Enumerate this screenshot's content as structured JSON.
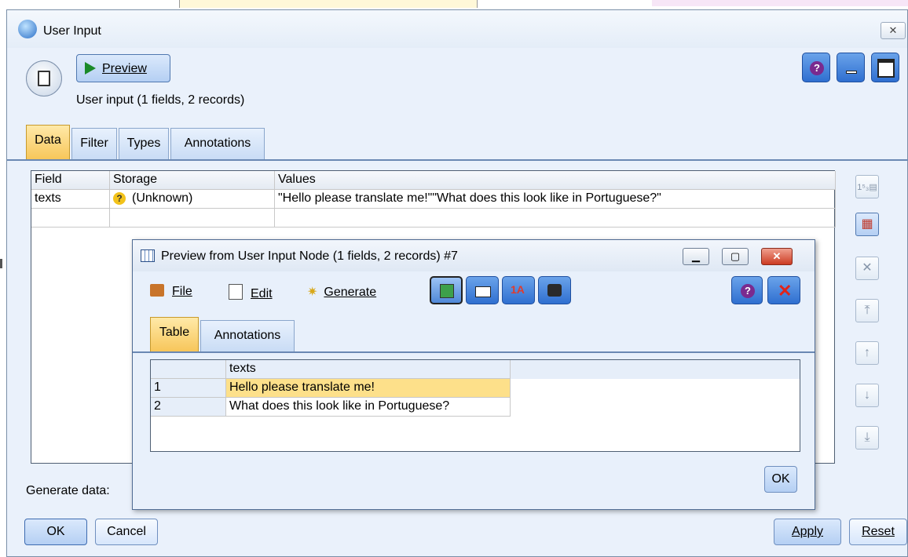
{
  "window": {
    "title": "User Input",
    "close_glyph": "✕"
  },
  "toolbar": {
    "preview_label": "Preview",
    "node_summary": "User input (1 fields, 2 records)"
  },
  "tabs": [
    {
      "label": "Data",
      "active": true
    },
    {
      "label": "Filter",
      "active": false
    },
    {
      "label": "Types",
      "active": false
    },
    {
      "label": "Annotations",
      "active": false
    }
  ],
  "data_grid": {
    "headers": [
      "Field",
      "Storage",
      "Values"
    ],
    "rows": [
      {
        "field": "texts",
        "storage": "(Unknown)",
        "values": "\"Hello please translate me!\"\"What does this look like in Portuguese?\""
      }
    ]
  },
  "side_buttons": [
    "numbers-icon",
    "insert-field-icon",
    "delete-icon",
    "move-top-icon",
    "move-up-icon",
    "move-down-icon",
    "move-bottom-icon"
  ],
  "footer": {
    "generate_label": "Generate data:",
    "ok_label": "OK",
    "cancel_label": "Cancel",
    "apply_label": "Apply",
    "reset_label": "Reset"
  },
  "preview_dialog": {
    "title": "Preview from User Input Node (1 fields, 2 records) #7",
    "menu": {
      "file": "File",
      "edit": "Edit",
      "generate": "Generate"
    },
    "tabs": [
      {
        "label": "Table",
        "active": true
      },
      {
        "label": "Annotations",
        "active": false
      }
    ],
    "table": {
      "column": "texts",
      "rows": [
        {
          "num": "1",
          "text": "Hello please translate me!"
        },
        {
          "num": "2",
          "text": "What does this look like in Portuguese?"
        }
      ]
    },
    "ok_label": "OK"
  },
  "colors": {
    "accent": "#2f6fd0",
    "tab_active": "#f7c65a",
    "selected_cell": "#fde08a"
  }
}
